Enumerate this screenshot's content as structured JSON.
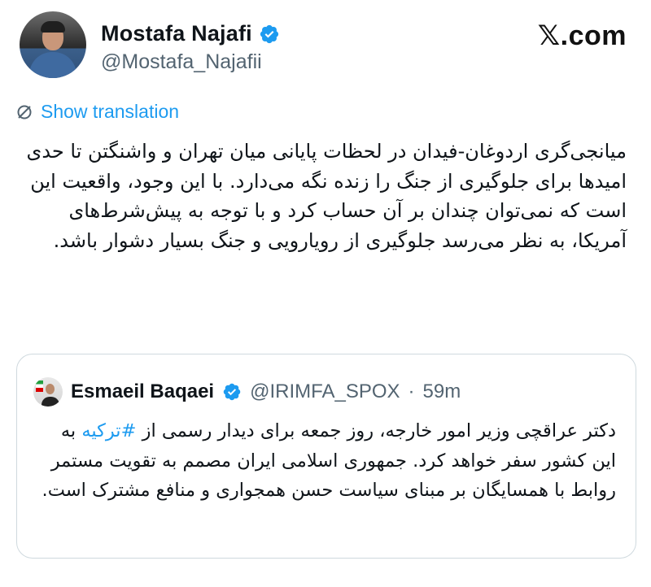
{
  "author": {
    "display_name": "Mostafa Najafi",
    "handle": "@Mostafa_Najafii",
    "verified": true
  },
  "brand": "𝕏.com",
  "translation_link": "Show translation",
  "tweet_text": "میانجی‌گری اردوغان-فیدان در لحظات پایانی میان تهران و واشنگتن تا حدی امیدها برای جلوگیری از جنگ را زنده نگه می‌دارد. با این وجود، واقعیت این است که نمی‌توان چندان بر آن حساب کرد و با توجه به پیش‌شرط‌های آمریکا، به نظر می‌رسد جلوگیری از رویارویی و جنگ بسیار دشوار باشد.",
  "quoted": {
    "display_name": "Esmaeil Baqaei",
    "handle": "@IRIMFA_SPOX",
    "separator": "·",
    "time": "59m",
    "text_before": "دکتر عراقچی وزیر امور خارجه، روز جمعه برای دیدار رسمی از ",
    "hashtag": "#ترکیه",
    "text_after": " به این کشور سفر خواهد کرد. جمهوری اسلامی ایران مصمم به تقویت مستمر روابط با همسایگان بر مبنای سیاست حسن همجواری و منافع مشترک است."
  },
  "colors": {
    "accent": "#1d9bf0",
    "secondary_text": "#536471",
    "border": "#cfd9de"
  },
  "icons": {
    "verified": "verified-badge-icon",
    "translate": "globe-slash-icon"
  }
}
